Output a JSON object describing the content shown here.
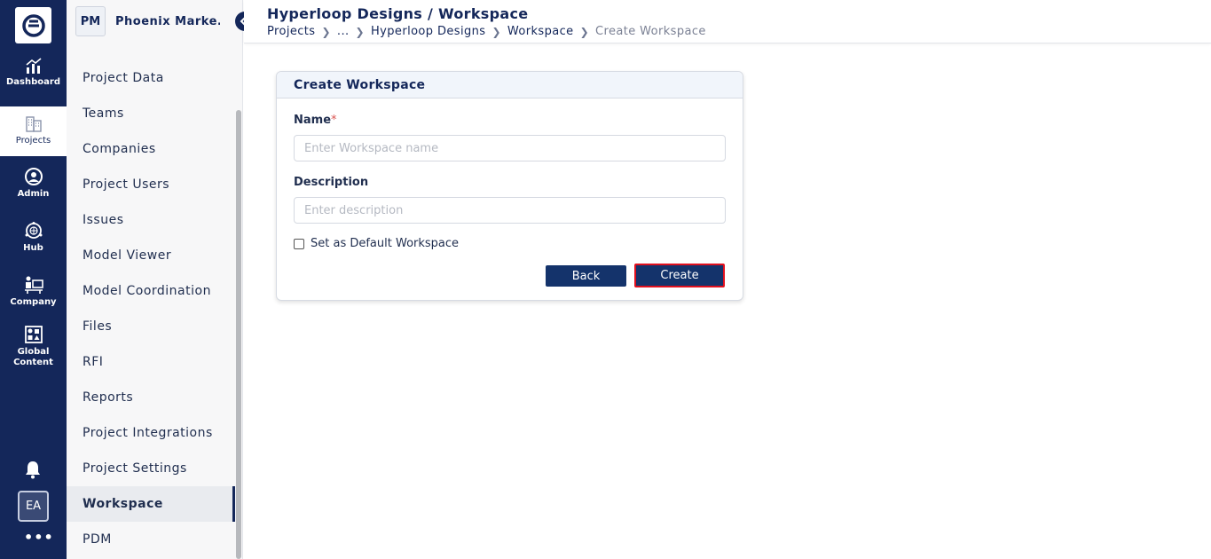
{
  "rail": {
    "items": [
      {
        "label": "Dashboard",
        "icon": "chart-icon"
      },
      {
        "label": "Projects",
        "icon": "buildings-icon"
      },
      {
        "label": "Admin",
        "icon": "user-circle-icon"
      },
      {
        "label": "Hub",
        "icon": "globe-hub-icon"
      },
      {
        "label": "Company",
        "icon": "company-icon"
      },
      {
        "label": "Global\nContent",
        "icon": "grid-content-icon"
      }
    ],
    "avatar": "EA",
    "more": "•••"
  },
  "project": {
    "initials": "PM",
    "name": "Phoenix Marke..."
  },
  "sidebar": {
    "items": [
      {
        "label": "Project Data"
      },
      {
        "label": "Teams"
      },
      {
        "label": "Companies"
      },
      {
        "label": "Project Users"
      },
      {
        "label": "Issues"
      },
      {
        "label": "Model Viewer"
      },
      {
        "label": "Model Coordination"
      },
      {
        "label": "Files"
      },
      {
        "label": "RFI"
      },
      {
        "label": "Reports"
      },
      {
        "label": "Project Integrations"
      },
      {
        "label": "Project Settings"
      },
      {
        "label": "Workspace"
      },
      {
        "label": "PDM"
      }
    ],
    "active": "Workspace"
  },
  "header": {
    "title": "Hyperloop Designs / Workspace",
    "breadcrumbs": [
      "Projects",
      "...",
      "Hyperloop Designs",
      "Workspace",
      "Create Workspace"
    ]
  },
  "form": {
    "title": "Create Workspace",
    "name_label": "Name",
    "required_mark": "*",
    "name_placeholder": "Enter Workspace name",
    "name_value": "",
    "description_label": "Description",
    "description_placeholder": "Enter description",
    "description_value": "",
    "default_label": "Set as Default Workspace",
    "default_checked": false,
    "back_label": "Back",
    "create_label": "Create"
  },
  "colors": {
    "navy": "#14275a",
    "button": "#14336b",
    "highlight": "#e0101e"
  }
}
